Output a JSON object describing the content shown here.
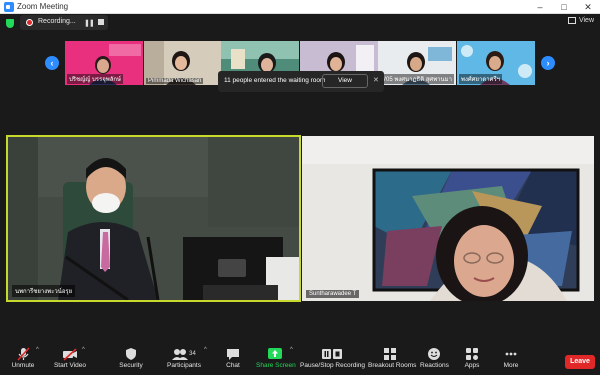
{
  "window": {
    "title": "Zoom Meeting",
    "min": "–",
    "max": "□",
    "close": "✕"
  },
  "recording": {
    "label": "Recording..."
  },
  "view": {
    "label": "View"
  },
  "thumbnails": [
    {
      "name": "ปริชญ์ญ์ บรรจุพลักษ์"
    },
    {
      "name": "Pimmada Wichasan"
    },
    {
      "name": ""
    },
    {
      "name": ""
    },
    {
      "name": "V05 พงศนาฏธิติ สุศพานมา"
    },
    {
      "name": "พงศ์ศยาดาศรีฯ"
    }
  ],
  "toast": {
    "message": "11 people entered the waiting room",
    "button": "View",
    "close": "✕"
  },
  "videos": {
    "left": {
      "name": "นพการีชยางพะวน์อรุย"
    },
    "right": {
      "name": "Suntharawadee T"
    }
  },
  "toolbar": {
    "unmute": "Unmute",
    "start_video": "Start Video",
    "security": "Security",
    "participants": "Participants",
    "participants_count": "34",
    "chat": "Chat",
    "share_screen": "Share Screen",
    "record": "Pause/Stop Recording",
    "breakout": "Breakout Rooms",
    "reactions": "Reactions",
    "apps": "Apps",
    "more": "More",
    "leave": "Leave"
  },
  "colors": {
    "accent": "#2d8cff",
    "share": "#23d959",
    "leave": "#e02828",
    "active_speaker": "#c8d92e"
  }
}
